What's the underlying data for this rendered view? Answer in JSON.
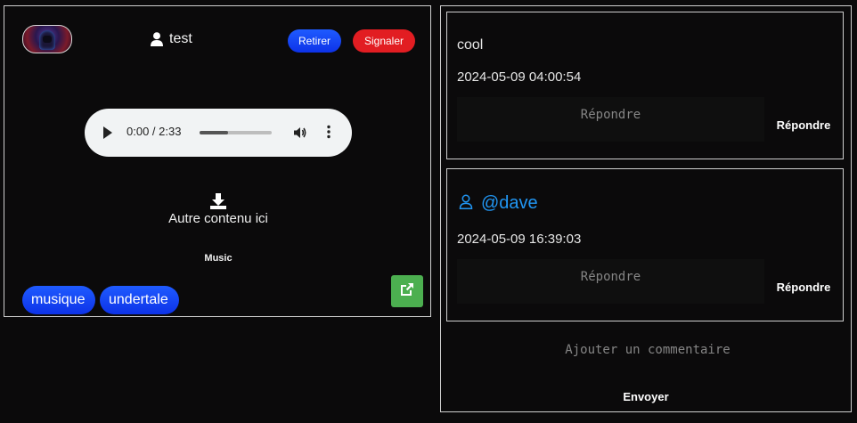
{
  "post": {
    "username": "test",
    "buttons": {
      "retirer": "Retirer",
      "signaler": "Signaler"
    },
    "audio": {
      "time": "0:00 / 2:33",
      "progress": 0.4
    },
    "other_content": "Autre contenu ici",
    "category": "Music",
    "tags": [
      "musique",
      "undertale"
    ],
    "colors": {
      "accent_blue": "#1f5bff",
      "danger": "#e21d22",
      "success": "#4caf50"
    }
  },
  "comments": [
    {
      "text": "cool",
      "date": "2024-05-09 04:00:54",
      "reply_placeholder": "Répondre",
      "reply_label": "Répondre"
    },
    {
      "author": "@dave",
      "date": "2024-05-09 16:39:03",
      "reply_placeholder": "Répondre",
      "reply_label": "Répondre"
    }
  ],
  "add_comment": {
    "placeholder": "Ajouter un commentaire",
    "send_label": "Envoyer"
  },
  "icons": [
    "user-icon",
    "play-icon",
    "volume-icon",
    "more-vert-icon",
    "download-icon",
    "external-link-icon",
    "user-outline-icon"
  ]
}
